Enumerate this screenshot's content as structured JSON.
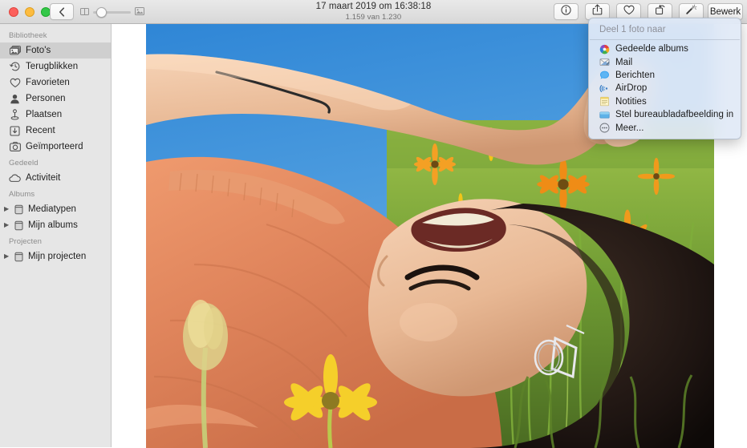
{
  "window": {
    "title": "17 maart 2019 om 16:38:18",
    "subtitle": "1.159 van 1.230"
  },
  "traffic_lights": {
    "close": "close-button",
    "minimize": "minimize-button",
    "maximize": "maximize-button",
    "close_color": "#fc605c",
    "minimize_color": "#fdbc40",
    "maximize_color": "#34c749"
  },
  "toolbar": {
    "back_icon": "chevron-left-icon",
    "zoom_min_icon": "grid-thumbnails-icon",
    "zoom_max_icon": "single-photo-icon",
    "zoom_value": 12,
    "info_icon": "info-circle-icon",
    "share_icon": "share-icon",
    "favorite_icon": "heart-icon",
    "rotate_icon": "rotate-icon",
    "enhance_icon": "magic-wand-icon",
    "edit_label": "Bewerk"
  },
  "sidebar": {
    "sections": [
      {
        "header": "Bibliotheek",
        "items": [
          {
            "label": "Foto's",
            "icon": "photos-stack-icon",
            "selected": true
          },
          {
            "label": "Terugblikken",
            "icon": "memories-clock-icon",
            "selected": false
          },
          {
            "label": "Favorieten",
            "icon": "heart-icon",
            "selected": false
          },
          {
            "label": "Personen",
            "icon": "person-icon",
            "selected": false
          },
          {
            "label": "Plaatsen",
            "icon": "location-pin-icon",
            "selected": false
          },
          {
            "label": "Recent",
            "icon": "download-box-icon",
            "selected": false
          },
          {
            "label": "Geïmporteerd",
            "icon": "camera-icon",
            "selected": false
          }
        ]
      },
      {
        "header": "Gedeeld",
        "items": [
          {
            "label": "Activiteit",
            "icon": "cloud-icon",
            "selected": false
          }
        ]
      },
      {
        "header": "Albums",
        "items": [
          {
            "label": "Mediatypen",
            "icon": "folder-icon",
            "selected": false,
            "disclosure": "▶"
          },
          {
            "label": "Mijn albums",
            "icon": "folder-icon",
            "selected": false,
            "disclosure": "▶"
          }
        ]
      },
      {
        "header": "Projecten",
        "items": [
          {
            "label": "Mijn projecten",
            "icon": "folder-icon",
            "selected": false,
            "disclosure": "▶"
          }
        ]
      }
    ]
  },
  "share_menu": {
    "title": "Deel 1 foto naar",
    "items": [
      {
        "label": "Gedeelde albums",
        "icon": "shared-albums-icon"
      },
      {
        "label": "Mail",
        "icon": "mail-icon"
      },
      {
        "label": "Berichten",
        "icon": "messages-icon"
      },
      {
        "label": "AirDrop",
        "icon": "airdrop-icon"
      },
      {
        "label": "Notities",
        "icon": "notes-icon"
      },
      {
        "label": "Stel bureaubladafbeelding in",
        "icon": "desktop-picture-icon"
      },
      {
        "label": "Meer...",
        "icon": "more-ellipsis-icon"
      }
    ]
  },
  "photo": {
    "description": "Vrouw liggend in bloemenveld, oranje trui, blauwe lucht",
    "sky_color": "#3e8fd6",
    "shirt_color": "#e0855c",
    "flower_orange": "#f08a1e",
    "flower_yellow": "#f2c518",
    "grass_color": "#7fa83c"
  }
}
